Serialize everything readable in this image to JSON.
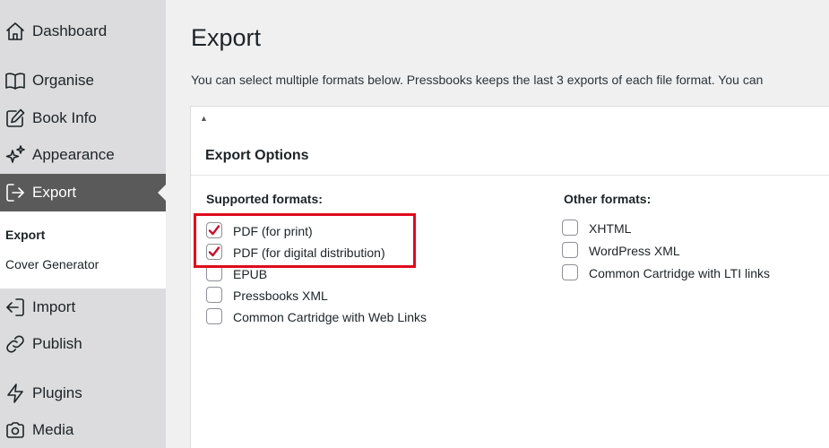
{
  "sidebar": {
    "items": [
      {
        "label": "Dashboard",
        "icon": "home-icon"
      },
      {
        "label": "Organise",
        "icon": "book-icon"
      },
      {
        "label": "Book Info",
        "icon": "edit-icon"
      },
      {
        "label": "Appearance",
        "icon": "sparkle-icon"
      },
      {
        "label": "Export",
        "icon": "export-icon",
        "active": true
      },
      {
        "label": "Import",
        "icon": "import-icon"
      },
      {
        "label": "Publish",
        "icon": "link-icon"
      },
      {
        "label": "Plugins",
        "icon": "plugin-icon"
      },
      {
        "label": "Media",
        "icon": "camera-icon"
      }
    ],
    "submenu": [
      {
        "label": "Export",
        "current": true
      },
      {
        "label": "Cover Generator"
      }
    ]
  },
  "main": {
    "title": "Export",
    "description": "You can select multiple formats below. Pressbooks keeps the last 3 exports of each file format. You can",
    "panel": {
      "toggle": "▲",
      "title": "Export Options",
      "supported": {
        "heading": "Supported formats:",
        "options": [
          {
            "label": "PDF (for print)",
            "checked": true
          },
          {
            "label": "PDF (for digital distribution)",
            "checked": true
          },
          {
            "label": "EPUB",
            "checked": false
          },
          {
            "label": "Pressbooks XML",
            "checked": false
          },
          {
            "label": "Common Cartridge with Web Links",
            "checked": false
          }
        ]
      },
      "other": {
        "heading": "Other formats:",
        "options": [
          {
            "label": "XHTML",
            "checked": false
          },
          {
            "label": "WordPress XML",
            "checked": false
          },
          {
            "label": "Common Cartridge with LTI links",
            "checked": false
          }
        ]
      }
    }
  },
  "colors": {
    "sidebar_bg": "#dcdcde",
    "active_bg": "#5a5a5a",
    "highlight": "#e00a1d",
    "check": "#c8102e"
  }
}
